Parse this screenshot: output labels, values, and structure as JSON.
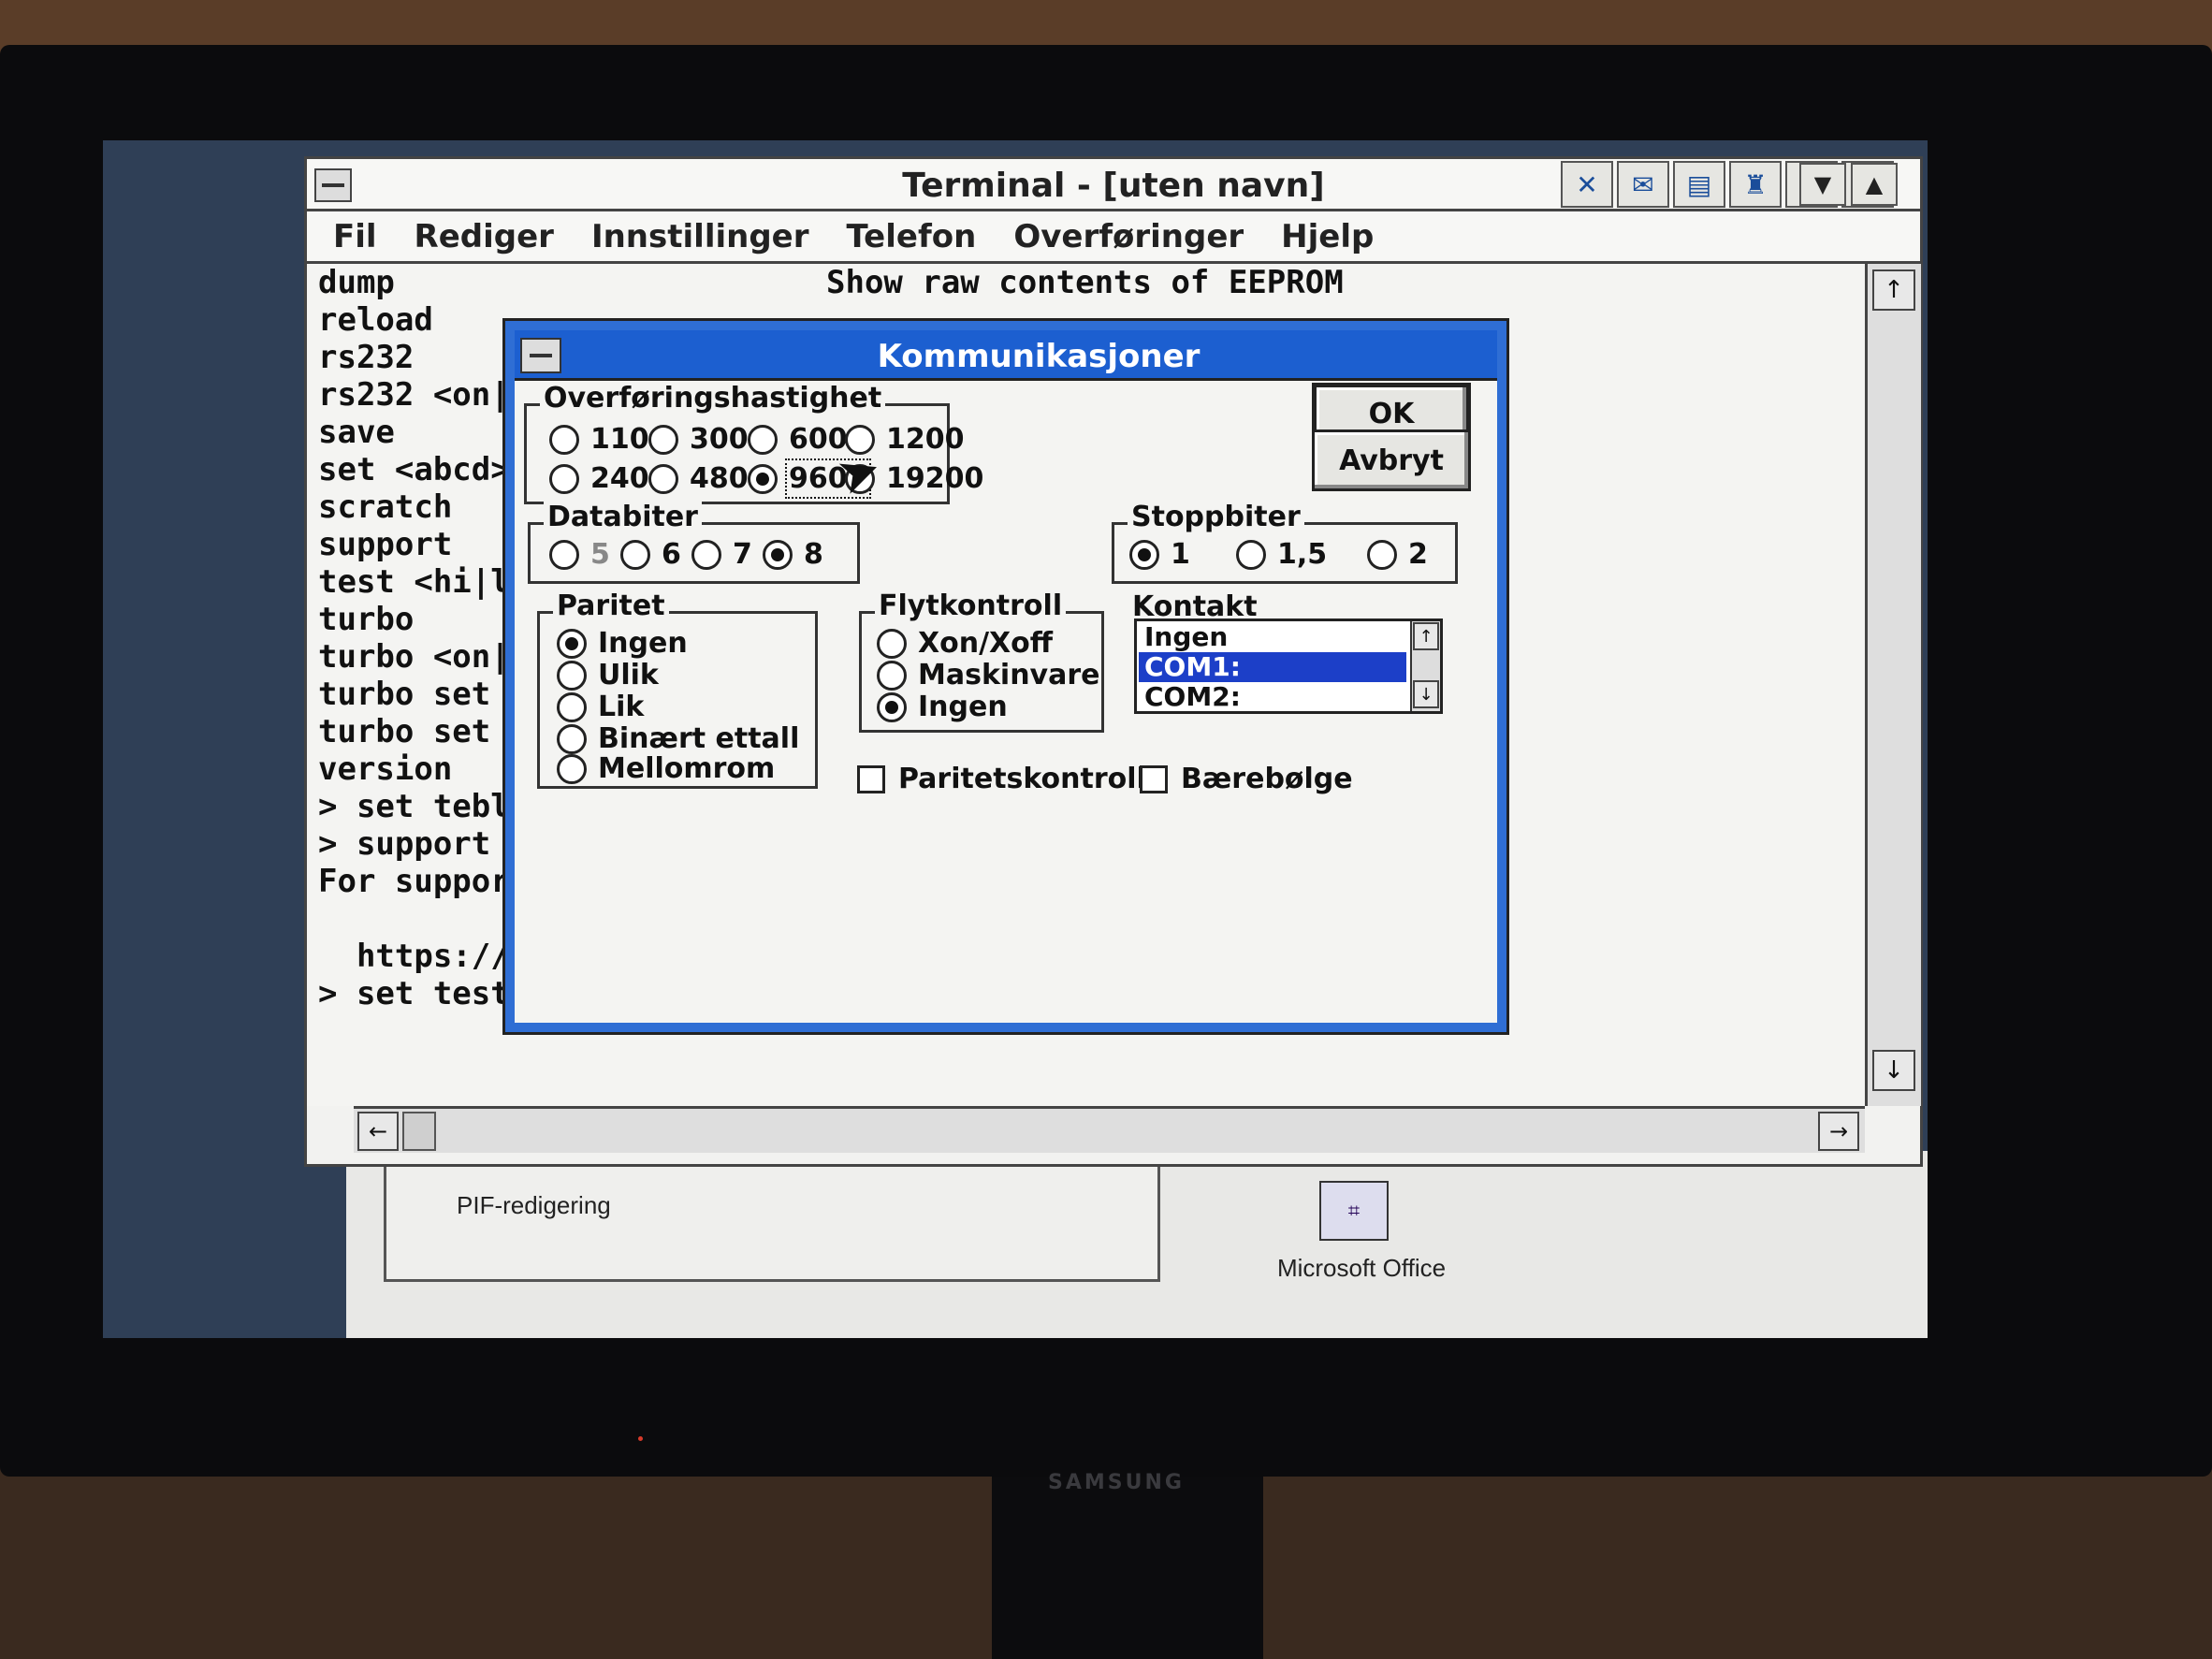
{
  "window": {
    "title": "Terminal - [uten navn]"
  },
  "menu": [
    "Fil",
    "Rediger",
    "Innstillinger",
    "Telefon",
    "Overføringer",
    "Hjelp"
  ],
  "terminal_lines": [
    "dump",
    "reload",
    "rs232",
    "rs232 <on|off>",
    "save",
    "set <abcd>",
    "scratch",
    "support",
    "test <hi|lo|bo",
    "turbo",
    "turbo <on|off>",
    "turbo set hi <",
    "turbo set lo <",
    "version",
    "> set tebl",
    "> support",
    "For support, p",
    "",
    "  https://gith",
    "> set test"
  ],
  "terminal_desc": "Show raw contents of EEPROM",
  "dialog": {
    "title": "Kommunikasjoner",
    "ok": "OK",
    "cancel": "Avbryt",
    "baud": {
      "label": "Overføringshastighet",
      "options": [
        "110",
        "300",
        "600",
        "1200",
        "2400",
        "4800",
        "9600",
        "19200"
      ],
      "selected": "9600"
    },
    "databits": {
      "label": "Databiter",
      "options": [
        "5",
        "6",
        "7",
        "8"
      ],
      "selected": "8"
    },
    "stopbits": {
      "label": "Stoppbiter",
      "options": [
        "1",
        "1,5",
        "2"
      ],
      "selected": "1"
    },
    "parity": {
      "label": "Paritet",
      "options": [
        "Ingen",
        "Ulik",
        "Lik",
        "Binært ettall",
        "Mellomrom"
      ],
      "selected": "Ingen"
    },
    "flow": {
      "label": "Flytkontroll",
      "options": [
        "Xon/Xoff",
        "Maskinvare",
        "Ingen"
      ],
      "selected": "Ingen"
    },
    "port": {
      "label": "Kontakt",
      "options": [
        "Ingen",
        "COM1:",
        "COM2:"
      ],
      "selected": "COM1:"
    },
    "parity_check": "Paritetskontroll",
    "carrier": "Bærebølge"
  },
  "desktop": {
    "pif_label": "PIF-redigering",
    "office_label": "Microsoft Office"
  },
  "monitor": {
    "brand": "SAMSUNG"
  },
  "colors": {
    "dialog_accent": "#2f6ed4",
    "selection": "#1c3fc8"
  }
}
